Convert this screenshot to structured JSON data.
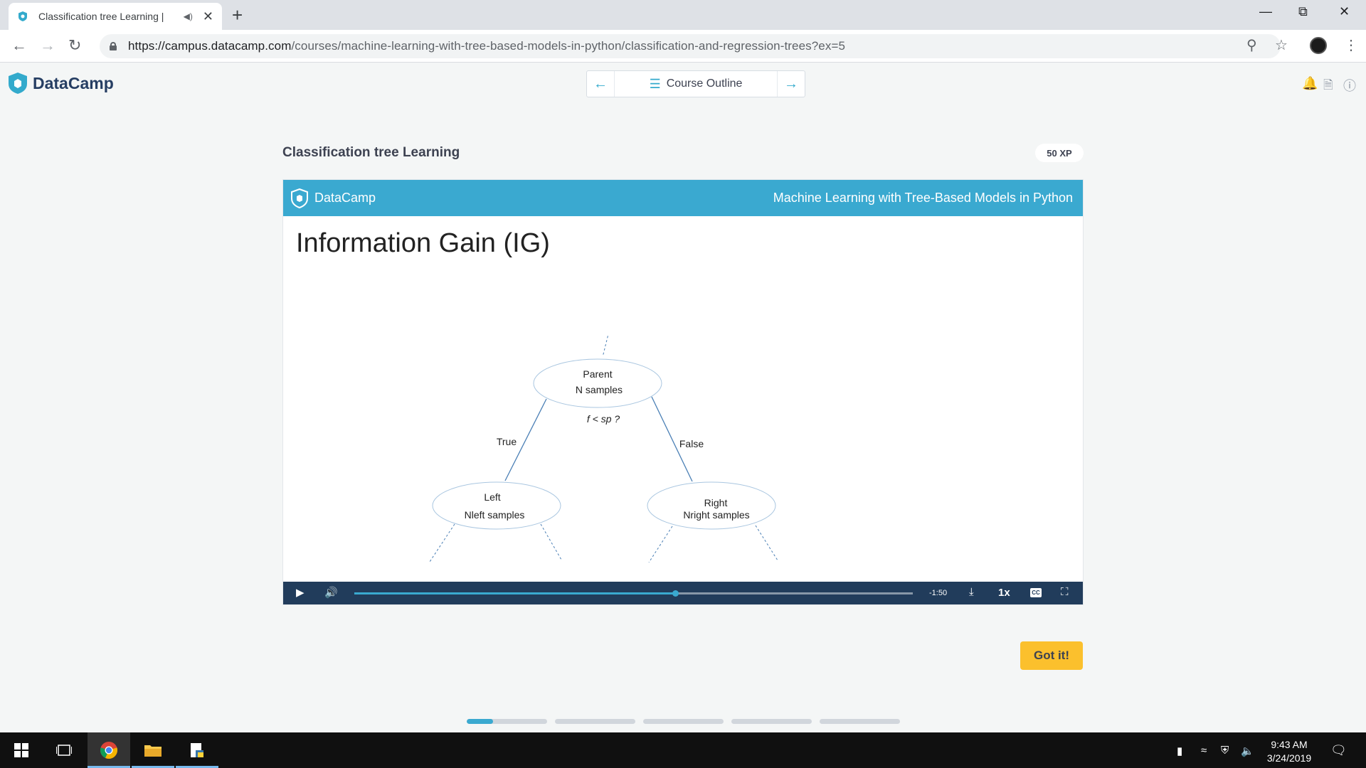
{
  "browser": {
    "tab_title": "Classification tree Learning |",
    "new_tab_symbol": "+",
    "url_host": "https://campus.datacamp.com",
    "url_path": "/courses/machine-learning-with-tree-based-models-in-python/classification-and-regression-trees?ex=5"
  },
  "header": {
    "brand": "DataCamp",
    "course_outline_label": "Course Outline",
    "accent_color": "#33aacc"
  },
  "exercise": {
    "title": "Classification tree Learning",
    "xp_badge": "50 XP",
    "got_it_label": "Got it!"
  },
  "slide": {
    "brand": "DataCamp",
    "course_name": "Machine Learning with Tree-Based Models in Python",
    "heading": "Information Gain (IG)",
    "bar_color": "#3aa9d0",
    "diagram": {
      "parent_line1": "Parent",
      "parent_line2": "N samples",
      "split_condition": "f < sp ?",
      "true_label": "True",
      "false_label": "False",
      "left_line1": "Left",
      "left_line2": "Nleft samples",
      "right_line1": "Right",
      "right_line2": "Nright samples"
    }
  },
  "player": {
    "time_remaining": "-1:50",
    "speed": "1x",
    "cc_label": "CC",
    "progress_fraction": 0.575
  },
  "lesson_progress": {
    "segments": 5,
    "first_segment_fill": 0.33
  },
  "taskbar": {
    "time": "9:43 AM",
    "date": "3/24/2019"
  }
}
